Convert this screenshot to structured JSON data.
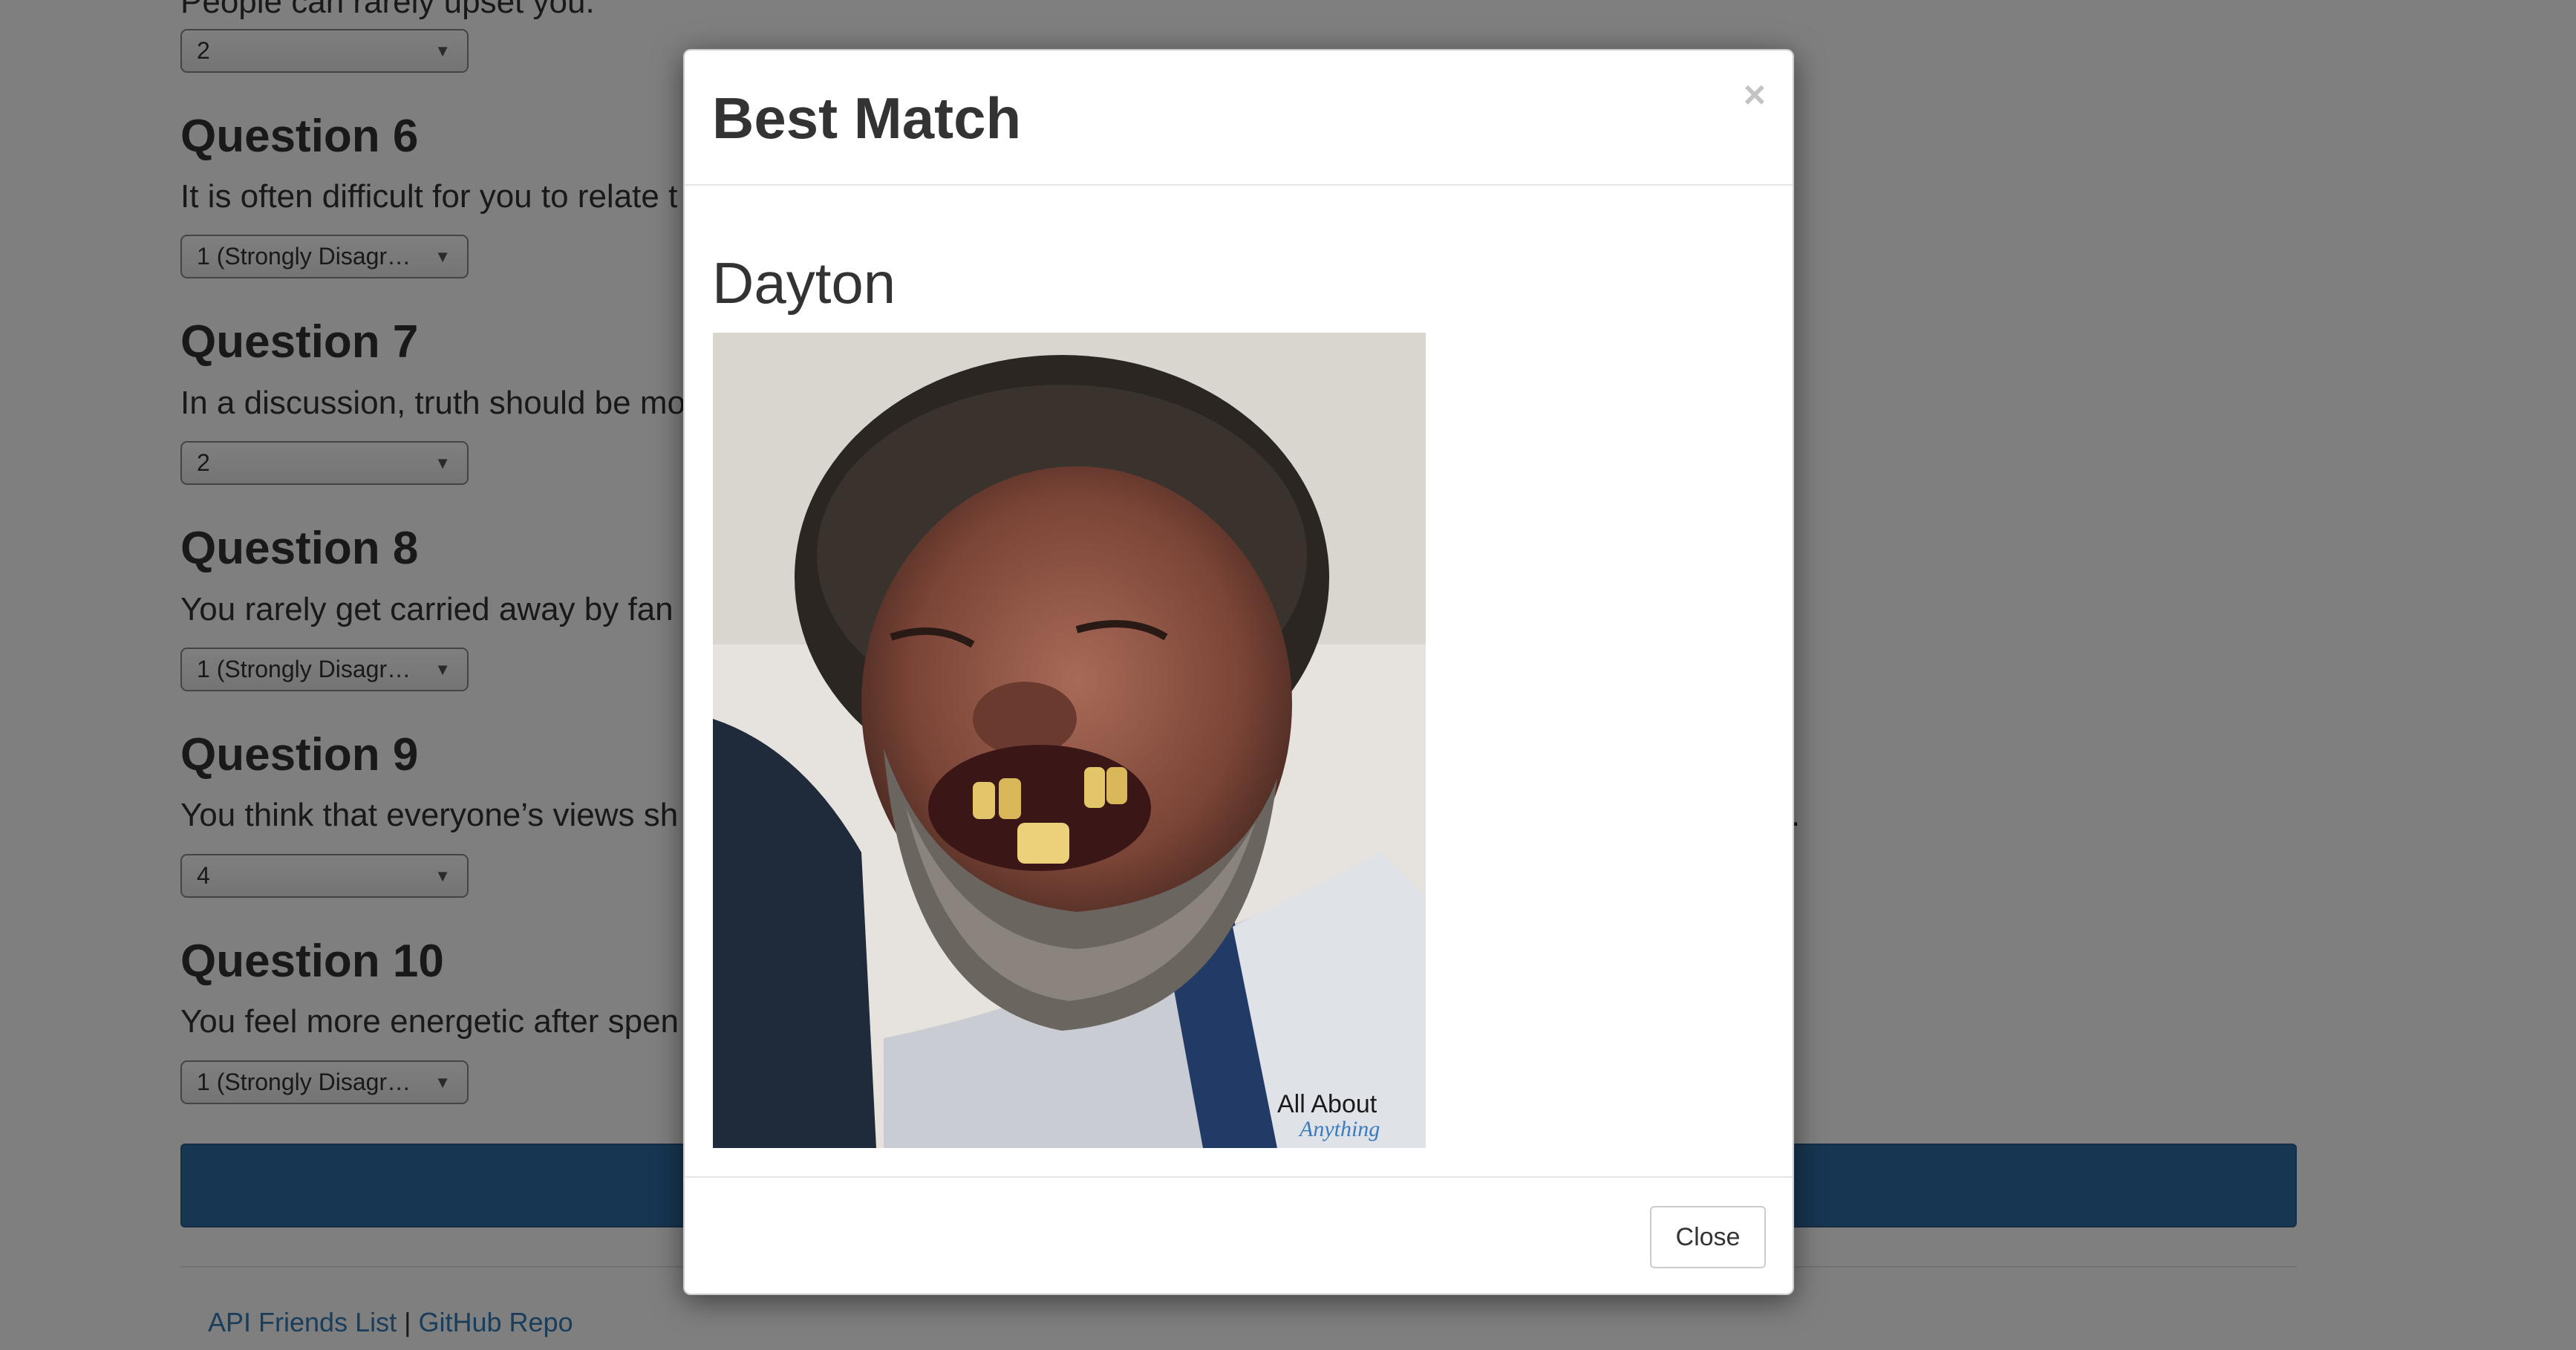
{
  "questions": [
    {
      "title": "",
      "text": "People can rarely upset you.",
      "answer": "2"
    },
    {
      "title": "Question 6",
      "text": "It is often difficult for you to relate t",
      "answer": "1 (Strongly Disagree)"
    },
    {
      "title": "Question 7",
      "text": "In a discussion, truth should be mo",
      "answer": "2"
    },
    {
      "title": "Question 8",
      "text": "You rarely get carried away by fan",
      "answer": "1 (Strongly Disagree)"
    },
    {
      "title": "Question 9",
      "text": "You think that everyone’s views sh",
      "answer": "4"
    },
    {
      "title": "Question 10",
      "text": "You feel more energetic after spen",
      "answer": "1 (Strongly Disagree)"
    }
  ],
  "question9_tail": ".",
  "footer": {
    "link1": "API Friends List",
    "separator": "|",
    "link2": "GitHub Repo"
  },
  "modal": {
    "title": "Best Match",
    "close_symbol": "×",
    "match_name": "Dayton",
    "photo_icon": "person-photo",
    "watermark": "All About Anything",
    "close_label": "Close"
  },
  "colors": {
    "submit": "#2e6da4",
    "link": "#337ab7",
    "backdrop_opacity": "0.5"
  }
}
